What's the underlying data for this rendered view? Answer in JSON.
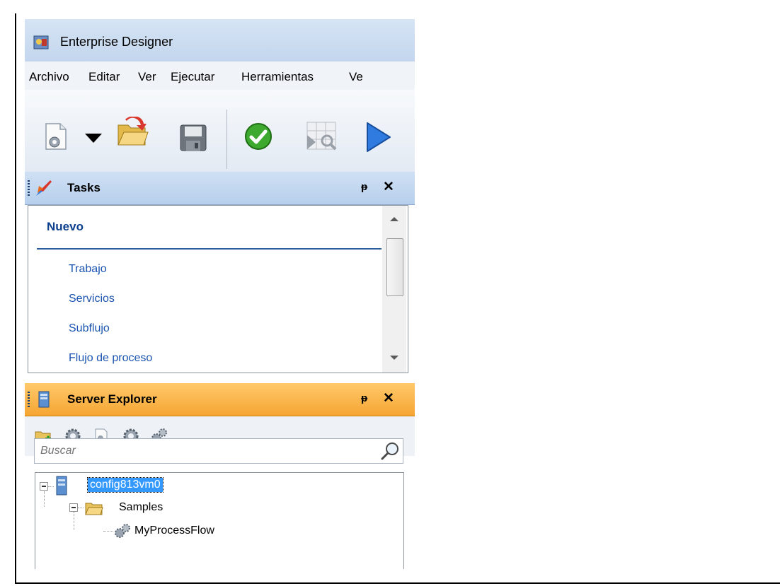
{
  "window": {
    "title": "Enterprise Designer"
  },
  "menu": {
    "items": [
      "Archivo",
      "Editar",
      "Ver",
      "Ejecutar",
      "Herramientas",
      "Ve"
    ]
  },
  "toolbar": {
    "icons": [
      "new-document-gear-icon",
      "dropdown-arrow-icon",
      "open-folder-icon",
      "save-icon",
      "validate-check-icon",
      "inspect-grid-icon",
      "run-play-icon"
    ]
  },
  "tasks_panel": {
    "title": "Tasks",
    "section": "Nuevo",
    "links": [
      "Trabajo",
      "Servicios",
      "Subflujo",
      "Flujo de proceso"
    ]
  },
  "server_explorer": {
    "title": "Server Explorer",
    "toolbar_icons": [
      "new-folder-icon",
      "gear-icon",
      "document-gear-icon",
      "gear-icon",
      "gears-icon"
    ],
    "search_placeholder": "Buscar",
    "tree": {
      "server": "config813vm0",
      "folder": "Samples",
      "item": "MyProcessFlow"
    }
  },
  "colors": {
    "tasks_header": "#b7cfec",
    "server_header": "#f6a532",
    "link": "#1a53b0",
    "selection": "#3399ff"
  }
}
